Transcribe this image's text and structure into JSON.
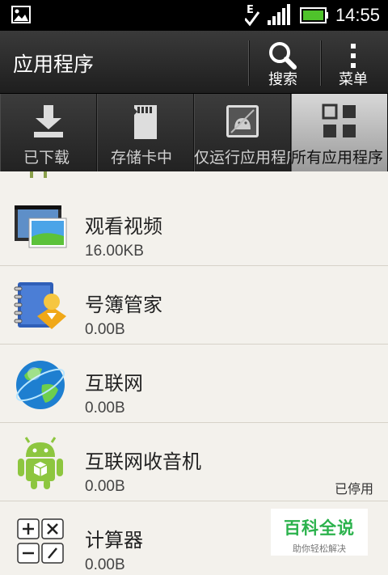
{
  "status_bar": {
    "time": "14:55",
    "network_letter": "E"
  },
  "action_bar": {
    "title": "应用程序",
    "search_label": "搜索",
    "menu_label": "菜单"
  },
  "tabs": [
    {
      "label": "已下载",
      "icon": "download-icon",
      "active": false
    },
    {
      "label": "存储卡中",
      "icon": "sd-card-icon",
      "active": false
    },
    {
      "label": "仅运行应用程序",
      "icon": "running-apps-icon",
      "active": false
    },
    {
      "label": "所有应用程序",
      "icon": "grid-icon",
      "active": true
    }
  ],
  "apps": [
    {
      "name": "观看视频",
      "size": "16.00KB",
      "status": "",
      "icon": "video-player-icon"
    },
    {
      "name": "号簿管家",
      "size": "0.00B",
      "status": "",
      "icon": "contacts-book-icon"
    },
    {
      "name": "互联网",
      "size": "0.00B",
      "status": "",
      "icon": "globe-icon"
    },
    {
      "name": "互联网收音机",
      "size": "0.00B",
      "status": "已停用",
      "icon": "android-package-icon"
    },
    {
      "name": "计算器",
      "size": "0.00B",
      "status": "",
      "icon": "calculator-icon"
    }
  ],
  "watermark": {
    "title": "百科全说",
    "subtitle": "助你轻松解决"
  },
  "colors": {
    "list_background": "#f3f1ec",
    "watermark_green": "#2bb24c",
    "battery_green": "#4fc32b"
  }
}
